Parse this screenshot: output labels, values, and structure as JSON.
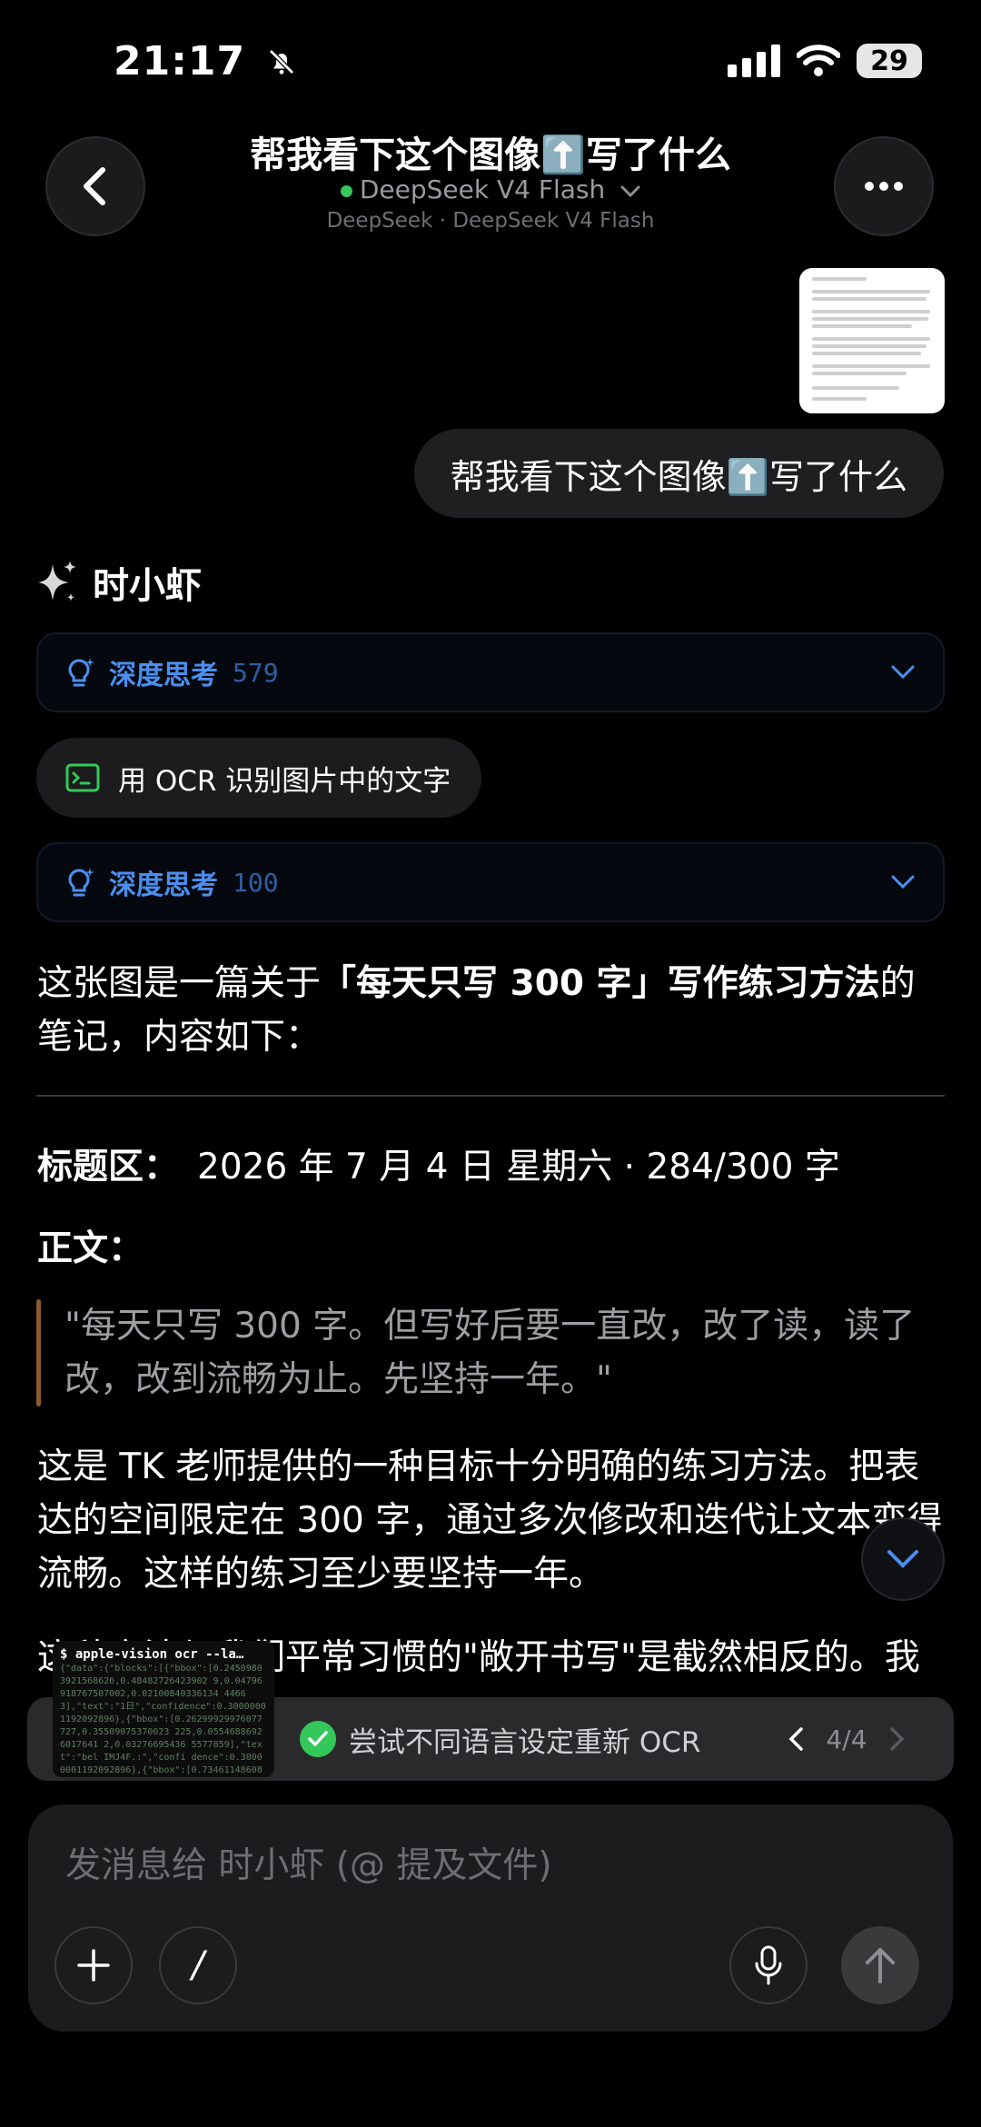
{
  "status_bar": {
    "time": "21:17",
    "battery": "29"
  },
  "header": {
    "title": "帮我看下这个图像⬆️写了什么",
    "model_name": "DeepSeek V4 Flash",
    "model_subtitle": "DeepSeek · DeepSeek V4 Flash"
  },
  "user_message": {
    "text": "帮我看下这个图像⬆️写了什么"
  },
  "assistant": {
    "name": "时小虾",
    "thinking_1": {
      "label": "深度思考",
      "count": "579"
    },
    "tool_call": {
      "label": "用 OCR 识别图片中的文字"
    },
    "thinking_2": {
      "label": "深度思考",
      "count": "100"
    },
    "intro_pre": "这张图是一篇关于",
    "intro_bold": "「每天只写 300 字」写作练习方法",
    "intro_post": "的笔记，内容如下：",
    "title_label": "标题区：",
    "title_value": "2026 年 7 月 4 日 星期六 · 284/300 字",
    "body_label": "正文：",
    "quote": "\"每天只写 300 字。但写好后要一直改，改了读，读了改，改到流畅为止。先坚持一年。\"",
    "paragraph_1": "这是 TK 老师提供的一种目标十分明确的练习方法。把表达的空间限定在 300 字，通过多次修改和迭代让文本变得流畅。这样的练习至少要坚持一年。",
    "paragraph_2_partial": "这种方法与我们平常习惯的\"敞开书写\"是截然相反的。我"
  },
  "ocr_status": {
    "text": "尝试不同语言设定重新 OCR",
    "pager": "4/4",
    "preview_cmd": "$ apple-vision ocr --la…",
    "preview_output": "{\"data\":{\"blocks\":[{\"bbox\":[0.24509803921568626,0.48482726423902 9,0.04796918767507002,0.02100840336134 44663],\"text\":\"1日\",\"confidence\":0.30000001192092896},{\"bbox\":[0.26299929976077727,0.35509075370023 225,0.05546886926017641 2,0.03276695436 5577859],\"text\":\"bel IMJ4F.:\",\"confi dence\":0.30000001192092896},{\"bbox\":[0.7346114860862323 9,0.3597275366970"
  },
  "composer": {
    "placeholder": "发消息给 时小虾 (@ 提及文件)",
    "slash": "/"
  }
}
